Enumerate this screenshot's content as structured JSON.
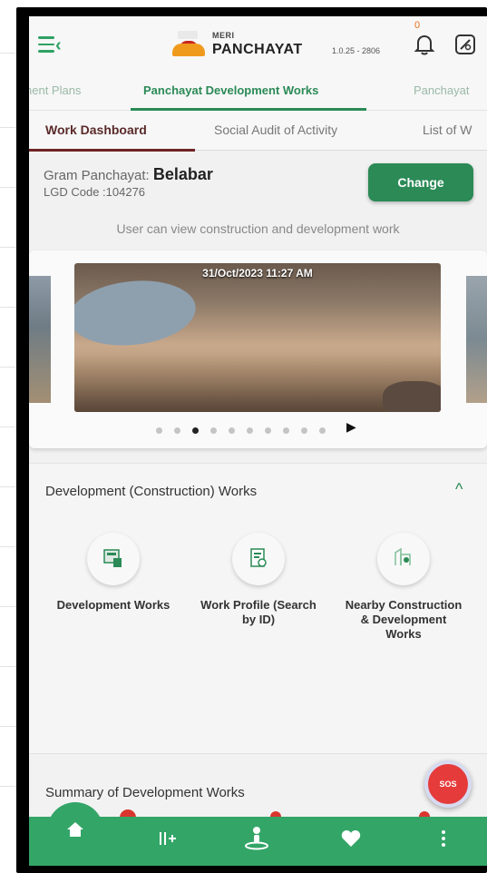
{
  "header": {
    "logo_small": "MERI",
    "logo_name": "PANCHAYAT",
    "version": "1.0.25 - 2806",
    "notification_count": "0"
  },
  "tabs": [
    {
      "label": "nent Plans"
    },
    {
      "label": "Panchayat Development Works"
    },
    {
      "label": "Panchayat"
    }
  ],
  "subtabs": [
    {
      "label": "Work Dashboard"
    },
    {
      "label": "Social Audit of Activity"
    },
    {
      "label": "List of W"
    }
  ],
  "panchayat": {
    "label": "Gram Panchayat:",
    "name": "Belabar",
    "lgd_code": "LGD Code :104276",
    "change_label": "Change"
  },
  "info_text": "User can view construction and development work",
  "carousel": {
    "timestamp": "31/Oct/2023 11:27 AM",
    "total_slides": 10,
    "active_slide": 3
  },
  "development": {
    "title": "Development (Construction) Works",
    "tiles": [
      {
        "label": "Development Works",
        "icon": "development-works-icon"
      },
      {
        "label": "Work Profile (Search by ID)",
        "icon": "work-profile-icon"
      },
      {
        "label": "Nearby Construction & Development Works",
        "icon": "nearby-works-icon"
      }
    ]
  },
  "summary": {
    "title": "Summary of Development Works"
  },
  "sos_label": "SOS",
  "bottom_nav": [
    "home-icon",
    "grid-plus-icon",
    "person-location-icon",
    "heart-icon",
    "more-vertical-icon"
  ],
  "colors": {
    "primary_green": "#2b8a56",
    "nav_green": "#33a567",
    "subtab_accent": "#6e2424",
    "sos_red": "#e53b3b"
  }
}
